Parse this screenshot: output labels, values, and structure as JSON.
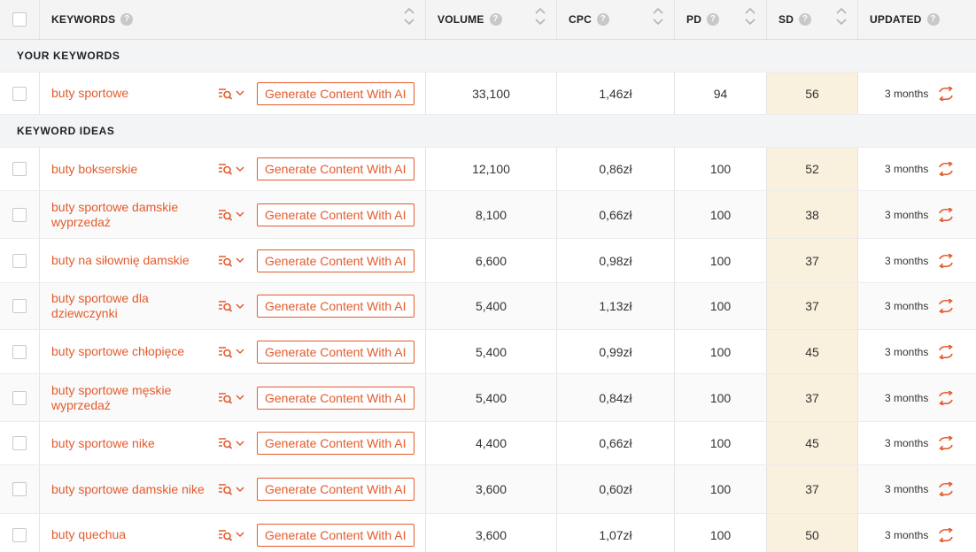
{
  "header": {
    "keywords": "KEYWORDS",
    "volume": "VOLUME",
    "cpc": "CPC",
    "pd": "PD",
    "sd": "SD",
    "updated": "UPDATED",
    "help_glyph": "?"
  },
  "sections": {
    "your_keywords": "YOUR KEYWORDS",
    "keyword_ideas": "KEYWORD IDEAS"
  },
  "generate_label": "Generate Content With AI",
  "your_keywords": [
    {
      "keyword": "buty sportowe",
      "volume": "33,100",
      "cpc": "1,46zł",
      "pd": "94",
      "sd": "56",
      "updated": "3 months"
    }
  ],
  "keyword_ideas": [
    {
      "keyword": "buty bokserskie",
      "volume": "12,100",
      "cpc": "0,86zł",
      "pd": "100",
      "sd": "52",
      "updated": "3 months"
    },
    {
      "keyword": "buty sportowe damskie wyprzedaż",
      "volume": "8,100",
      "cpc": "0,66zł",
      "pd": "100",
      "sd": "38",
      "updated": "3 months"
    },
    {
      "keyword": "buty na siłownię damskie",
      "volume": "6,600",
      "cpc": "0,98zł",
      "pd": "100",
      "sd": "37",
      "updated": "3 months"
    },
    {
      "keyword": "buty sportowe dla dziewczynki",
      "volume": "5,400",
      "cpc": "1,13zł",
      "pd": "100",
      "sd": "37",
      "updated": "3 months"
    },
    {
      "keyword": "buty sportowe chłopięce",
      "volume": "5,400",
      "cpc": "0,99zł",
      "pd": "100",
      "sd": "45",
      "updated": "3 months"
    },
    {
      "keyword": "buty sportowe męskie wyprzedaż",
      "volume": "5,400",
      "cpc": "0,84zł",
      "pd": "100",
      "sd": "37",
      "updated": "3 months"
    },
    {
      "keyword": "buty sportowe nike",
      "volume": "4,400",
      "cpc": "0,66zł",
      "pd": "100",
      "sd": "45",
      "updated": "3 months"
    },
    {
      "keyword": "buty sportowe damskie nike",
      "volume": "3,600",
      "cpc": "0,60zł",
      "pd": "100",
      "sd": "37",
      "updated": "3 months"
    },
    {
      "keyword": "buty quechua",
      "volume": "3,600",
      "cpc": "1,07zł",
      "pd": "100",
      "sd": "50",
      "updated": "3 months"
    }
  ],
  "colors": {
    "accent": "#e35b2d",
    "sd_highlight": "#faf0de",
    "header_bg": "#f4f4f4",
    "section_bg": "#f3f4f5"
  },
  "icons": {
    "sort": "sort-arrows-icon",
    "help": "help-icon",
    "keyword_tool": "list-search-icon",
    "dropdown": "chevron-down-icon",
    "refresh": "refresh-icon"
  }
}
